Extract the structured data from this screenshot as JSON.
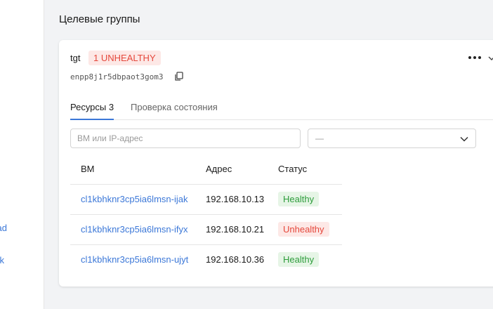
{
  "sidebar": {
    "links": [
      "ad",
      "k"
    ]
  },
  "section": {
    "title": "Целевые группы"
  },
  "target_group": {
    "name": "tgt",
    "health_badge": "1 UNHEALTHY",
    "id": "enpp8j1r5dbpaot3gom3",
    "tabs": [
      {
        "label": "Ресурсы 3",
        "active": true
      },
      {
        "label": "Проверка состояния",
        "active": false
      }
    ],
    "filters": {
      "search_placeholder": "ВМ или IP-адрес",
      "status_select_value": "—"
    },
    "table": {
      "headers": {
        "vm": "ВМ",
        "address": "Адрес",
        "status": "Статус"
      },
      "rows": [
        {
          "vm": "cl1kbhknr3cp5ia6lmsn-ijak",
          "address": "192.168.10.13",
          "status": "Healthy",
          "status_type": "healthy"
        },
        {
          "vm": "cl1kbhknr3cp5ia6lmsn-ifyx",
          "address": "192.168.10.21",
          "status": "Unhealthy",
          "status_type": "unhealthy"
        },
        {
          "vm": "cl1kbhknr3cp5ia6lmsn-ujyt",
          "address": "192.168.10.36",
          "status": "Healthy",
          "status_type": "healthy"
        }
      ]
    }
  },
  "colors": {
    "link": "#3c78d8",
    "healthy_text": "#2e9d3c",
    "healthy_bg": "#e6f5e6",
    "unhealthy_text": "#e5483c",
    "unhealthy_bg": "#fde8e6"
  }
}
